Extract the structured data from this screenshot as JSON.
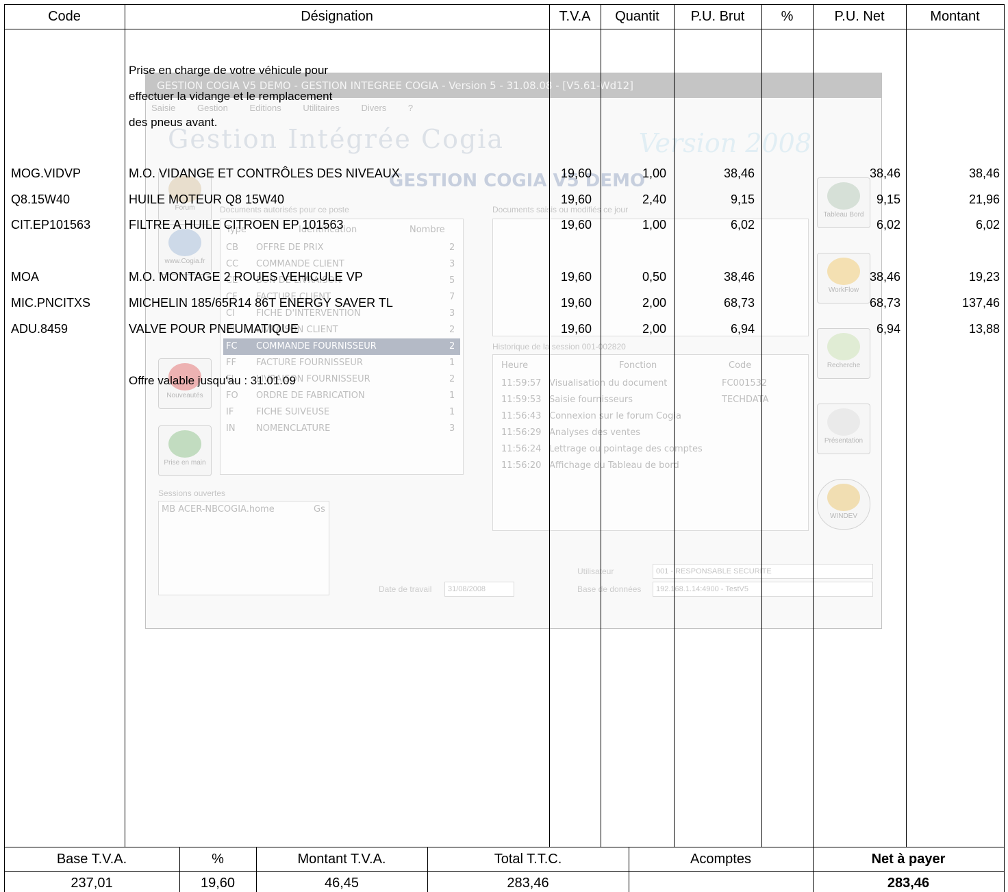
{
  "headers": {
    "code": "Code",
    "designation": "Désignation",
    "tva": "T.V.A",
    "quantite": "Quantit",
    "pu_brut": "P.U. Brut",
    "pct": "%",
    "pu_net": "P.U. Net",
    "montant": "Montant"
  },
  "intro": {
    "line1": "Prise en charge de votre véhicule pour",
    "line2": "effectuer la vidange et le remplacement",
    "line3": "des pneus avant."
  },
  "rows": [
    {
      "code": "MOG.VIDVP",
      "designation": "M.O. VIDANGE ET CONTRÔLES DES NIVEAUX",
      "tva": "19,60",
      "qte": "1,00",
      "pu_brut": "38,46",
      "pct": "",
      "pu_net": "38,46",
      "montant": "38,46"
    },
    {
      "code": "Q8.15W40",
      "designation": "HUILE MOTEUR Q8 15W40",
      "tva": "19,60",
      "qte": "2,40",
      "pu_brut": "9,15",
      "pct": "",
      "pu_net": "9,15",
      "montant": "21,96"
    },
    {
      "code": "CIT.EP101563",
      "designation": "FILTRE A HUILE CITROEN EP 101563",
      "tva": "19,60",
      "qte": "1,00",
      "pu_brut": "6,02",
      "pct": "",
      "pu_net": "6,02",
      "montant": "6,02"
    },
    {
      "code": "MOA",
      "designation": "M.O. MONTAGE 2 ROUES VEHICULE VP",
      "tva": "19,60",
      "qte": "0,50",
      "pu_brut": "38,46",
      "pct": "",
      "pu_net": "38,46",
      "montant": "19,23"
    },
    {
      "code": "MIC.PNCITXS",
      "designation": "MICHELIN 185/65R14 86T ENERGY SAVER TL",
      "tva": "19,60",
      "qte": "2,00",
      "pu_brut": "68,73",
      "pct": "",
      "pu_net": "68,73",
      "montant": "137,46"
    },
    {
      "code": "ADU.8459",
      "designation": "VALVE POUR PNEUMATIQUE",
      "tva": "19,60",
      "qte": "2,00",
      "pu_brut": "6,94",
      "pct": "",
      "pu_net": "6,94",
      "montant": "13,88"
    }
  ],
  "offer": "Offre valable jusqu'au : 31.01.09",
  "footer": {
    "headers": {
      "base": "Base T.V.A.",
      "pct": "%",
      "montant_tva": "Montant T.V.A.",
      "total_ttc": "Total T.T.C.",
      "acomptes": "Acomptes",
      "net": "Net à payer"
    },
    "values": {
      "base": "237,01",
      "pct": "19,60",
      "montant_tva": "46,45",
      "total_ttc": "283,46",
      "acomptes": "",
      "net": "283,46"
    }
  },
  "background_screenshot": {
    "title": "GESTION COGIA V5 DEMO - GESTION INTEGREE COGIA - Version 5 - 31.08.08 - [V5.61-Wd12]",
    "menu": [
      "Saisie",
      "Gestion",
      "Editions",
      "Utilitaires",
      "Divers",
      "?"
    ],
    "banner": "Gestion Intégrée Cogia",
    "version": "Version 2008",
    "demo": "GESTION COGIA V5 DEMO",
    "docs_title": "Documents autorisés pour ce poste",
    "docs_day_title": "Documents saisis ou modifiés ce jour",
    "docs_columns": [
      "Type",
      "Identification",
      "Nombre"
    ],
    "docs": [
      {
        "type": "CB",
        "label": "OFFRE DE PRIX",
        "n": "2"
      },
      {
        "type": "CC",
        "label": "COMMANDE CLIENT",
        "n": "3"
      },
      {
        "type": "CE",
        "label": "BON DE LIVRAISON",
        "n": "5"
      },
      {
        "type": "CF",
        "label": "FACTURE CLIENT",
        "n": "7"
      },
      {
        "type": "CI",
        "label": "FICHE D'INTERVENTION",
        "n": "3"
      },
      {
        "type": "CL",
        "label": "LIVRAISON CLIENT",
        "n": "2"
      },
      {
        "type": "FC",
        "label": "COMMANDE FOURNISSEUR",
        "n": "2"
      },
      {
        "type": "FF",
        "label": "FACTURE FOURNISSEUR",
        "n": "1"
      },
      {
        "type": "FL",
        "label": "LIVRAISON FOURNISSEUR",
        "n": "2"
      },
      {
        "type": "FO",
        "label": "ORDRE DE FABRICATION",
        "n": "1"
      },
      {
        "type": "IF",
        "label": "FICHE SUIVEUSE",
        "n": "1"
      },
      {
        "type": "IN",
        "label": "NOMENCLATURE",
        "n": "3"
      }
    ],
    "history_title": "Historique de la session 001-002820",
    "history_columns": [
      "Heure",
      "Fonction",
      "Code"
    ],
    "history": [
      {
        "h": "11:59:57",
        "f": "Visualisation du document",
        "c": "FC001532"
      },
      {
        "h": "11:59:53",
        "f": "Saisie fournisseurs",
        "c": "TECHDATA"
      },
      {
        "h": "11:56:43",
        "f": "Connexion sur le forum Cogia",
        "c": ""
      },
      {
        "h": "11:56:29",
        "f": "Analyses des ventes",
        "c": ""
      },
      {
        "h": "11:56:24",
        "f": "Lettrage ou pointage des comptes",
        "c": ""
      },
      {
        "h": "11:56:20",
        "f": "Affichage du Tableau de bord",
        "c": ""
      }
    ],
    "sessions_title": "Sessions ouvertes",
    "session": "MB ACER-NBCOGIA.home",
    "session_suffix": "Gs",
    "date_label": "Date de travail",
    "date_value": "31/08/2008",
    "user_label": "Utilisateur",
    "user_value": "001 - RESPONSABLE SECURITE",
    "db_label": "Base de données",
    "db_value": "192.168.1.14:4900 - TestV5",
    "left_icons": [
      "Forum",
      "www.Cogia.fr",
      "Nouveautés",
      "Prise en main"
    ],
    "right_icons": [
      "Tableau Bord",
      "WorkFlow",
      "Recherche",
      "Présentation",
      "WINDEV"
    ]
  }
}
